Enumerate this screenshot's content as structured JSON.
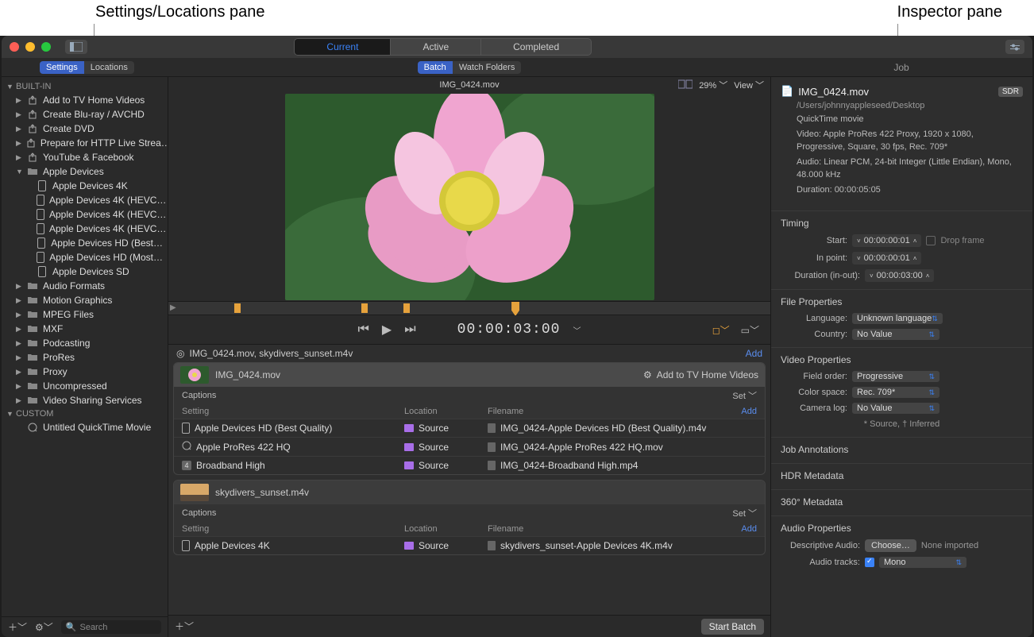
{
  "annotations": {
    "left": "Settings/Locations pane",
    "right": "Inspector pane"
  },
  "titlebar": {
    "tabs": {
      "current": "Current",
      "active": "Active",
      "completed": "Completed"
    }
  },
  "secondary": {
    "settings": "Settings",
    "locations": "Locations",
    "batch": "Batch",
    "watch_folders": "Watch Folders",
    "job": "Job"
  },
  "sidebar": {
    "builtin_label": "BUILT-IN",
    "custom_label": "CUSTOM",
    "builtin": [
      {
        "label": "Add to TV Home Videos",
        "icon": "share"
      },
      {
        "label": "Create Blu-ray / AVCHD",
        "icon": "share"
      },
      {
        "label": "Create DVD",
        "icon": "share"
      },
      {
        "label": "Prepare for HTTP Live Strea…",
        "icon": "share"
      },
      {
        "label": "YouTube & Facebook",
        "icon": "share"
      },
      {
        "label": "Apple Devices",
        "icon": "folder",
        "expanded": true,
        "children": [
          "Apple Devices 4K",
          "Apple Devices 4K (HEVC…",
          "Apple Devices 4K (HEVC…",
          "Apple Devices 4K (HEVC…",
          "Apple Devices HD (Best…",
          "Apple Devices HD (Most…",
          "Apple Devices SD"
        ]
      },
      {
        "label": "Audio Formats",
        "icon": "folder"
      },
      {
        "label": "Motion Graphics",
        "icon": "folder"
      },
      {
        "label": "MPEG Files",
        "icon": "folder"
      },
      {
        "label": "MXF",
        "icon": "folder"
      },
      {
        "label": "Podcasting",
        "icon": "folder"
      },
      {
        "label": "ProRes",
        "icon": "folder"
      },
      {
        "label": "Proxy",
        "icon": "folder"
      },
      {
        "label": "Uncompressed",
        "icon": "folder"
      },
      {
        "label": "Video Sharing Services",
        "icon": "folder"
      }
    ],
    "custom": [
      {
        "label": "Untitled QuickTime Movie",
        "icon": "qt"
      }
    ],
    "search_placeholder": "Search"
  },
  "preview": {
    "filename": "IMG_0424.mov",
    "zoom": "29%",
    "view_label": "View",
    "timecode": "00:00:03:00"
  },
  "batch": {
    "title": "IMG_0424.mov, skydivers_sunset.m4v",
    "add_label": "Add",
    "captions_label": "Captions",
    "set_label": "Set",
    "col_setting": "Setting",
    "col_location": "Location",
    "col_filename": "Filename",
    "jobs": [
      {
        "name": "IMG_0424.mov",
        "action": "Add to TV Home Videos",
        "thumb": "flower",
        "rows": [
          {
            "setting": "Apple Devices HD (Best Quality)",
            "icon": "dev",
            "location": "Source",
            "filename": "IMG_0424-Apple Devices HD (Best Quality).m4v"
          },
          {
            "setting": "Apple ProRes 422 HQ",
            "icon": "qt",
            "location": "Source",
            "filename": "IMG_0424-Apple ProRes 422 HQ.mov"
          },
          {
            "setting": "Broadband High",
            "icon": "4",
            "location": "Source",
            "filename": "IMG_0424-Broadband High.mp4"
          }
        ]
      },
      {
        "name": "skydivers_sunset.m4v",
        "thumb": "sky",
        "rows": [
          {
            "setting": "Apple Devices 4K",
            "icon": "dev",
            "location": "Source",
            "filename": "skydivers_sunset-Apple Devices 4K.m4v"
          }
        ]
      }
    ],
    "start_batch": "Start Batch"
  },
  "inspector": {
    "filename": "IMG_0424.mov",
    "sdr": "SDR",
    "path": "/Users/johnnyappleseed/Desktop",
    "container": "QuickTime movie",
    "video_info": "Video: Apple ProRes 422 Proxy, 1920 x 1080, Progressive, Square, 30 fps, Rec. 709*",
    "audio_info": "Audio: Linear PCM, 24-bit Integer (Little Endian), Mono, 48.000 kHz",
    "duration_info": "Duration: 00:00:05:05",
    "timing_title": "Timing",
    "start_label": "Start:",
    "start_val": "00:00:00:01",
    "inpoint_label": "In point:",
    "inpoint_val": "00:00:00:01",
    "duration_label": "Duration (in-out):",
    "duration_val": "00:00:03:00",
    "dropframe": "Drop frame",
    "fileprops_title": "File Properties",
    "language_label": "Language:",
    "language_val": "Unknown language",
    "country_label": "Country:",
    "country_val": "No Value",
    "videoprops_title": "Video Properties",
    "fieldorder_label": "Field order:",
    "fieldorder_val": "Progressive",
    "colorspace_label": "Color space:",
    "colorspace_val": "Rec. 709*",
    "cameralog_label": "Camera log:",
    "cameralog_val": "No Value",
    "source_note": "* Source, † Inferred",
    "jobann_title": "Job Annotations",
    "hdr_title": "HDR Metadata",
    "meta360_title": "360° Metadata",
    "audioprops_title": "Audio Properties",
    "descaudio_label": "Descriptive Audio:",
    "choose": "Choose…",
    "none_imported": "None imported",
    "audiotracks_label": "Audio tracks:",
    "audiotracks_val": "Mono"
  }
}
